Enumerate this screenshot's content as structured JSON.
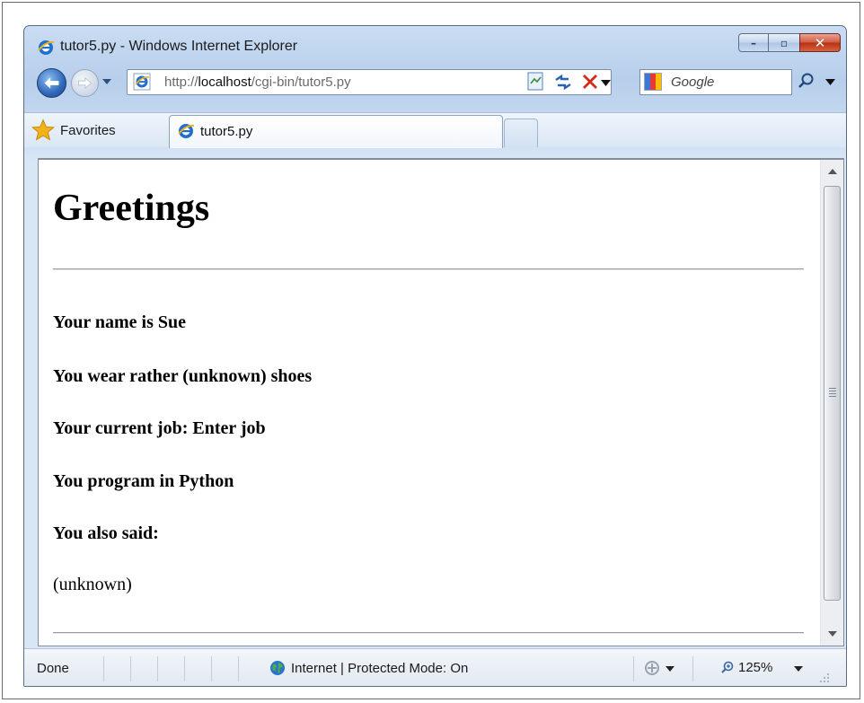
{
  "window": {
    "title": "tutor5.py - Windows Internet Explorer",
    "controls": {
      "minimize": "–",
      "maximize": "▫",
      "close": "✕"
    }
  },
  "address_bar": {
    "url_prefix": "http://",
    "url_host": "localhost",
    "url_path": "/cgi-bin/tutor5.py"
  },
  "search": {
    "placeholder": "Google"
  },
  "favorites": {
    "label": "Favorites"
  },
  "tab": {
    "label": "tutor5.py"
  },
  "page": {
    "heading": "Greetings",
    "lines": [
      {
        "text": "Your name is Sue",
        "bold": true
      },
      {
        "text": "You wear rather (unknown) shoes",
        "bold": true
      },
      {
        "text": "Your current job: Enter job",
        "bold": true
      },
      {
        "text": "You program in Python",
        "bold": true
      },
      {
        "text": "You also said:",
        "bold": true
      },
      {
        "text": "(unknown)",
        "bold": false
      }
    ]
  },
  "status_bar": {
    "status": "Done",
    "zone": "Internet | Protected Mode: On",
    "zoom": "125%"
  },
  "icons": {
    "ie": "ie-logo-icon",
    "favorites": "star-icon",
    "globe": "globe-icon",
    "zoom": "magnifier-icon"
  },
  "colors": {
    "ie_blue": "#1e6fd0",
    "close_red": "#c7381c",
    "star_gold": "#f2b21b"
  }
}
